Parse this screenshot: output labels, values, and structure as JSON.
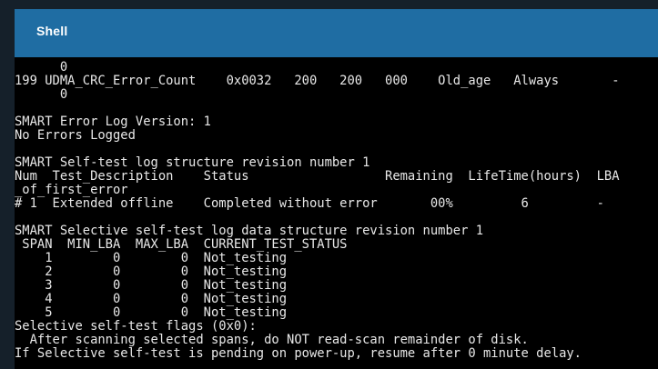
{
  "window": {
    "title": "Shell"
  },
  "terminal": {
    "lines": [
      "      0",
      "199 UDMA_CRC_Error_Count    0x0032   200   200   000    Old_age   Always       -",
      "      0",
      "",
      "SMART Error Log Version: 1",
      "No Errors Logged",
      "",
      "SMART Self-test log structure revision number 1",
      "Num  Test_Description    Status                  Remaining  LifeTime(hours)  LBA",
      "_of_first_error",
      "# 1  Extended offline    Completed without error       00%         6         -",
      "",
      "SMART Selective self-test log data structure revision number 1",
      " SPAN  MIN_LBA  MAX_LBA  CURRENT_TEST_STATUS",
      "    1        0        0  Not_testing",
      "    2        0        0  Not_testing",
      "    3        0        0  Not_testing",
      "    4        0        0  Not_testing",
      "    5        0        0  Not_testing",
      "Selective self-test flags (0x0):",
      "  After scanning selected spans, do NOT read-scan remainder of disk.",
      "If Selective self-test is pending on power-up, resume after 0 minute delay."
    ]
  }
}
